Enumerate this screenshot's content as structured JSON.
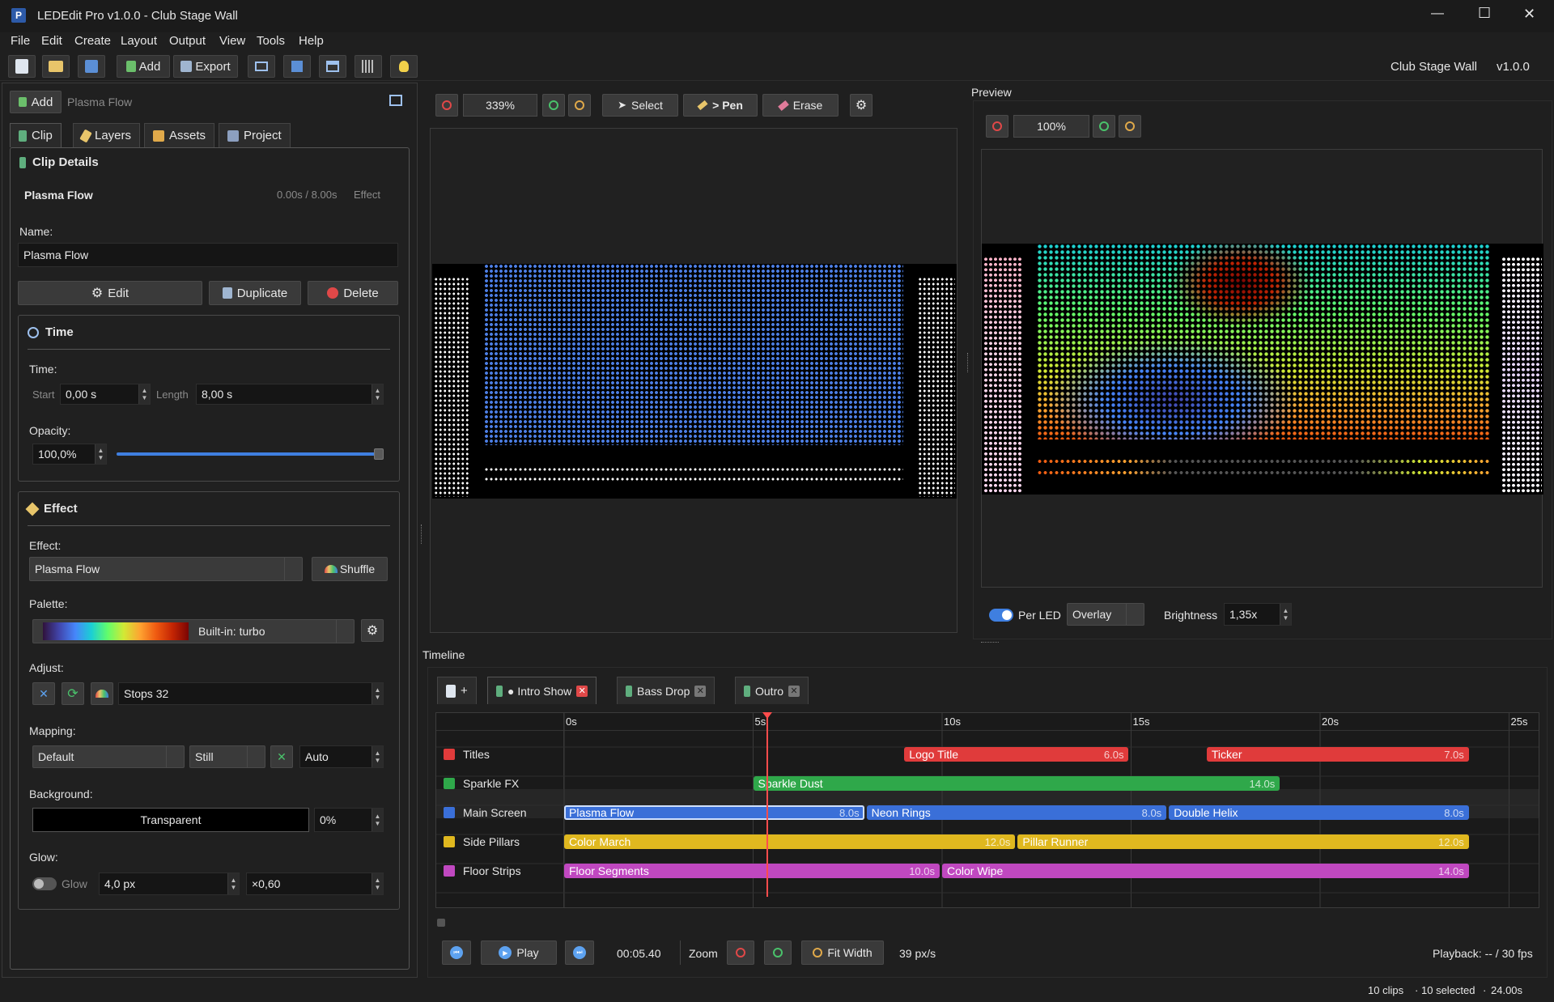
{
  "window": {
    "title": "LEDEdit Pro v1.0.0 - Club Stage Wall",
    "controls": {
      "minimize": "—",
      "maximize": "☐",
      "close": "✕"
    }
  },
  "menu": [
    "File",
    "Edit",
    "Create",
    "Layout",
    "Output",
    "View",
    "Tools",
    "Help"
  ],
  "toolbar": {
    "add_label": "Add",
    "export_label": "Export",
    "project_name": "Club Stage Wall",
    "version": "v1.0.0"
  },
  "left_panel": {
    "add_label": "Add",
    "current_clip": "Plasma Flow",
    "tabs": [
      "Clip",
      "Layers",
      "Assets",
      "Project"
    ],
    "clip_details": {
      "title": "Clip Details",
      "clip_name": "Plasma Flow",
      "time_range": "0.00s / 8.00s",
      "kind": "Effect",
      "name_label": "Name:",
      "name_value": "Plasma Flow",
      "edit": "Edit",
      "duplicate": "Duplicate",
      "delete": "Delete"
    },
    "time": {
      "title": "Time",
      "time_label": "Time:",
      "start_label": "Start",
      "start_value": "0,00 s",
      "length_label": "Length",
      "length_value": "8,00 s",
      "opacity_label": "Opacity:",
      "opacity_value": "100,0%",
      "opacity_fraction": 1.0
    },
    "effect": {
      "title": "Effect",
      "effect_label": "Effect:",
      "effect_value": "Plasma Flow",
      "shuffle": "Shuffle",
      "palette_label": "Palette:",
      "palette_value": "Built-in: turbo",
      "adjust_label": "Adjust:",
      "stops_value": "Stops 32",
      "mapping_label": "Mapping:",
      "mapping_value": "Default",
      "motion_value": "Still",
      "auto_value": "Auto",
      "background_label": "Background:",
      "background_value": "Transparent",
      "background_pct": "0%",
      "glow_label": "Glow:",
      "glow_toggle_label": "Glow",
      "glow_px": "4,0 px",
      "glow_mult": "×0,60"
    }
  },
  "editor": {
    "zoom": "339%",
    "select": "Select",
    "pen": "> Pen",
    "erase": "Erase"
  },
  "preview": {
    "title": "Preview",
    "zoom": "100%",
    "per_led": "Per LED",
    "overlay": "Overlay",
    "brightness_label": "Brightness",
    "brightness_value": "1,35x"
  },
  "timeline": {
    "title": "Timeline",
    "add_tab": "+",
    "tabs": [
      "● Intro Show",
      "Bass Drop",
      "Outro"
    ],
    "ruler": [
      "0s",
      "5s",
      "10s",
      "15s",
      "20s",
      "25s"
    ],
    "tracks": [
      {
        "name": "Titles",
        "color": "#e03b3b"
      },
      {
        "name": "Sparkle FX",
        "color": "#2fa84a"
      },
      {
        "name": "Main Screen",
        "color": "#3a6fd8"
      },
      {
        "name": "Side Pillars",
        "color": "#e0b81f"
      },
      {
        "name": "Floor Strips",
        "color": "#c048c0"
      }
    ],
    "clips": [
      {
        "track": 0,
        "name": "Logo Title",
        "start": 9.0,
        "duration": 6.0,
        "label": "6.0s"
      },
      {
        "track": 0,
        "name": "Ticker",
        "start": 17.0,
        "duration": 7.0,
        "label": "7.0s"
      },
      {
        "track": 1,
        "name": "Sparkle Dust",
        "start": 5.0,
        "duration": 14.0,
        "label": "14.0s"
      },
      {
        "track": 2,
        "name": "Plasma Flow",
        "start": 0.0,
        "duration": 8.0,
        "label": "8.0s"
      },
      {
        "track": 2,
        "name": "Neon Rings",
        "start": 8.0,
        "duration": 8.0,
        "label": "8.0s"
      },
      {
        "track": 2,
        "name": "Double Helix",
        "start": 16.0,
        "duration": 8.0,
        "label": "8.0s"
      },
      {
        "track": 3,
        "name": "Color March",
        "start": 0.0,
        "duration": 12.0,
        "label": "12.0s"
      },
      {
        "track": 3,
        "name": "Pillar Runner",
        "start": 12.0,
        "duration": 12.0,
        "label": "12.0s"
      },
      {
        "track": 4,
        "name": "Floor Segments",
        "start": 0.0,
        "duration": 10.0,
        "label": "10.0s"
      },
      {
        "track": 4,
        "name": "Color Wipe",
        "start": 10.0,
        "duration": 14.0,
        "label": "14.0s"
      }
    ],
    "playhead_seconds": 5.4,
    "play": "Play",
    "timecode": "00:05.40",
    "zoom_label": "Zoom",
    "fit_width": "Fit Width",
    "px_per_s": "39 px/s",
    "playback": "Playback: -- / 30 fps"
  },
  "status": {
    "clips": "10 clips",
    "selected": "10 selected",
    "time": "24.00s"
  }
}
